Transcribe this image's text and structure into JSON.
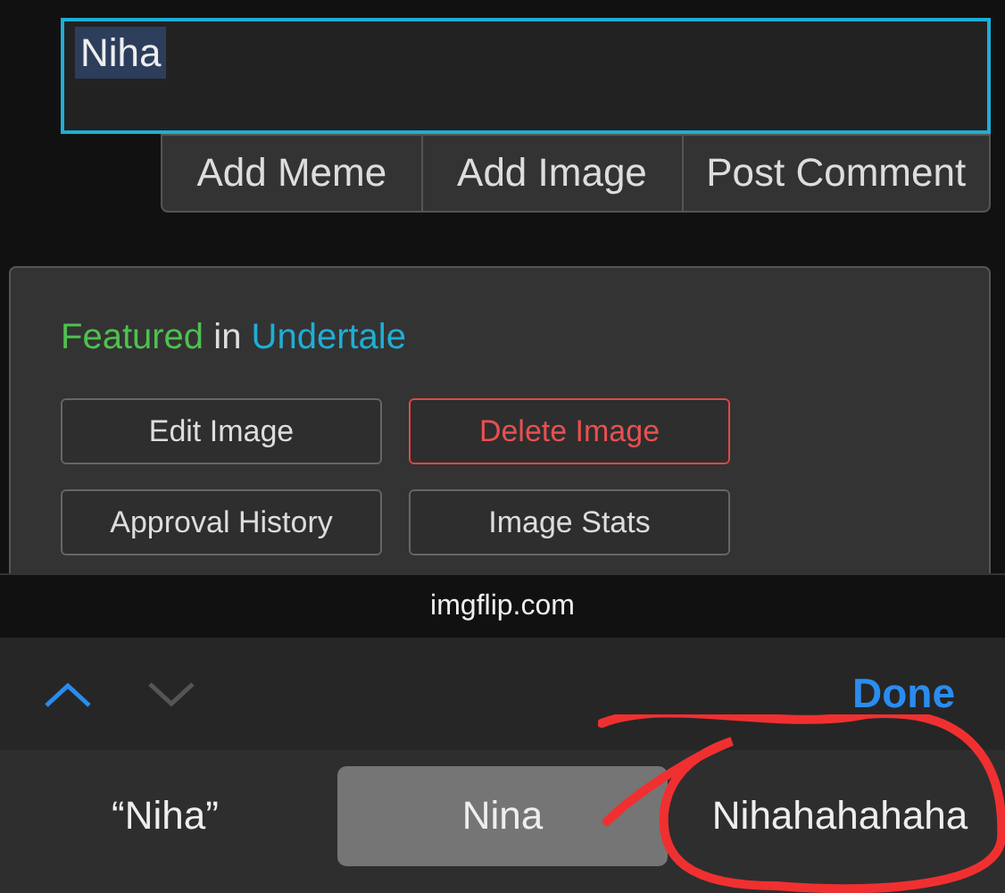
{
  "comment_box": {
    "value": "Niha",
    "selected_text": true
  },
  "comment_buttons": [
    "Add Meme",
    "Add Image",
    "Post Comment"
  ],
  "featured": {
    "prefix": "Featured",
    "joiner": "in",
    "stream": "Undertale"
  },
  "image_actions": [
    {
      "label": "Edit Image",
      "kind": "normal"
    },
    {
      "label": "Delete Image",
      "kind": "danger"
    },
    {
      "label": "Approval History",
      "kind": "normal"
    },
    {
      "label": "Image Stats",
      "kind": "normal"
    }
  ],
  "address_bar": {
    "url": "imgflip.com"
  },
  "keyboard_toolbar": {
    "previous_enabled": true,
    "next_enabled": false,
    "done": "Done"
  },
  "suggestions": [
    {
      "label": "“Niha”",
      "selected": false
    },
    {
      "label": "Nina",
      "selected": true
    },
    {
      "label": "Nihahahahaha",
      "selected": false
    }
  ],
  "annotation": {
    "kind": "circle"
  }
}
